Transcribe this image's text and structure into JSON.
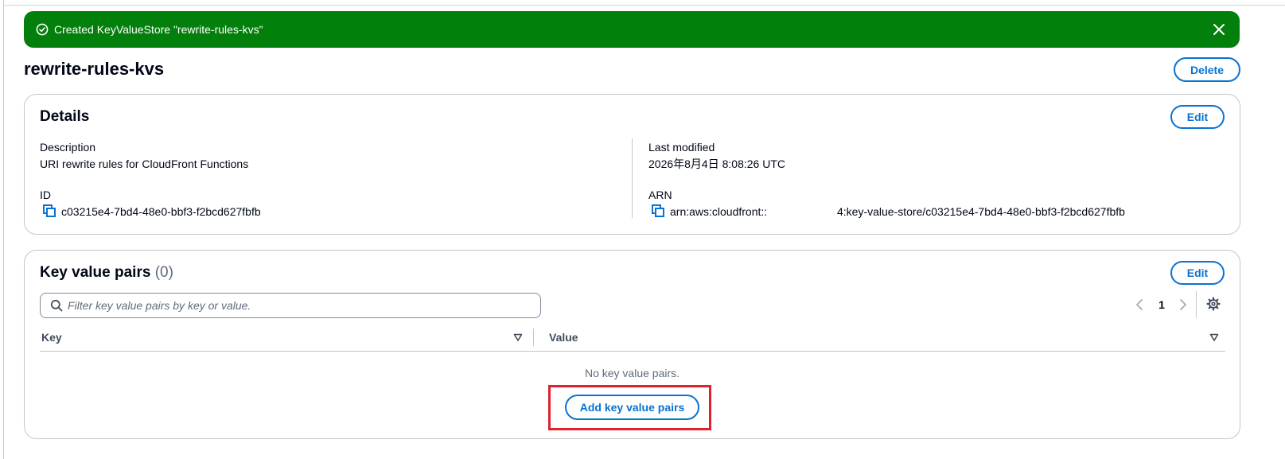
{
  "flash": {
    "message": "Created KeyValueStore \"rewrite-rules-kvs\"",
    "icon": "check-circle-icon",
    "dismiss_icon": "close-icon",
    "color": "#037f0c"
  },
  "header": {
    "title": "rewrite-rules-kvs",
    "delete_label": "Delete"
  },
  "details": {
    "title": "Details",
    "edit_label": "Edit",
    "description_label": "Description",
    "description_value": "URI rewrite rules for CloudFront Functions",
    "id_label": "ID",
    "id_value": "c03215e4-7bd4-48e0-bbf3-f2bcd627fbfb",
    "last_modified_label": "Last modified",
    "last_modified_value": "2026年8月4日 8:08:26 UTC",
    "arn_label": "ARN",
    "arn_prefix": "arn:aws:cloudfront::",
    "arn_suffix": "4:key-value-store/c03215e4-7bd4-48e0-bbf3-f2bcd627fbfb"
  },
  "kvp": {
    "title": "Key value pairs",
    "count": "(0)",
    "edit_label": "Edit",
    "filter_placeholder": "Filter key value pairs by key or value.",
    "filter_value": "",
    "page": "1",
    "columns": [
      "Key",
      "Value"
    ],
    "empty_text": "No key value pairs.",
    "add_label": "Add key value pairs"
  },
  "colors": {
    "accent": "#0972d3",
    "success": "#037f0c",
    "highlight": "#e3202d",
    "border": "#c6c6cd"
  }
}
